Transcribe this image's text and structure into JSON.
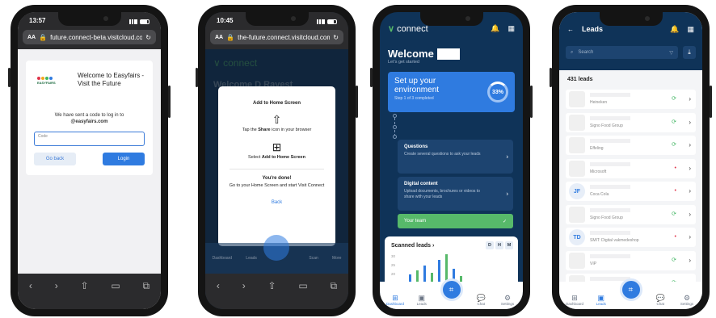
{
  "phone1": {
    "time": "13:57",
    "url": "future.connect-beta.visitcloud.com",
    "url_aa": "AA",
    "logo_text": "EASYFAIRS",
    "welcome": "Welcome to Easyfairs - Visit the Future",
    "sent_line": "We have sent a code to log in to",
    "sent_domain": "@easyfairs.com",
    "code_label": "Code",
    "back_label": "Go back",
    "login_label": "Login"
  },
  "phone2": {
    "time": "10:45",
    "url": "the-future.connect.visitcloud.com",
    "url_aa": "AA",
    "bg_logo": "connect",
    "bg_welcome": "Welcome D Ravest",
    "modal": {
      "title": "Add to Home Screen",
      "step1_pre": "Tap the",
      "step1_bold": "Share",
      "step1_post": "icon in your browser",
      "step2_pre": "Select",
      "step2_bold": "Add to Home Screen",
      "done_title": "You're done!",
      "done_text": "Go to your Home Screen and start Visit Connect",
      "back_label": "Back"
    },
    "tabs": [
      "Dashboard",
      "Leads",
      "Scan",
      "More"
    ]
  },
  "phone3": {
    "brand_main": "connect",
    "welcome": "Welcome",
    "subtitle": "Let's get started",
    "setup_title": "Set up your environment",
    "setup_sub": "Step 1 of 3 completed",
    "progress_label": "33%",
    "progress_value": 33,
    "tasks": [
      {
        "title": "Questions",
        "desc": "Create several questions to ask your leads"
      },
      {
        "title": "Digital content",
        "desc": "Upload documents, brochures or videos to share with your leads"
      }
    ],
    "team_label": "Your team",
    "scanned_title": "Scanned leads",
    "ranges": [
      "D",
      "H",
      "M"
    ],
    "tabs": [
      "Dashboard",
      "Leads",
      "Chat",
      "Settings"
    ],
    "chart_data": {
      "type": "bar",
      "title": "Scanned leads",
      "ticks": [
        "30",
        "25",
        "20"
      ],
      "ylim": [
        0,
        30
      ],
      "series": [
        {
          "values": [
            8,
            12,
            18,
            10,
            24,
            30,
            14,
            6
          ]
        }
      ]
    }
  },
  "phone4": {
    "title": "Leads",
    "search_placeholder": "Search",
    "count_label": "431 leads",
    "leads": [
      {
        "initials": "",
        "company": "Heineken",
        "status": "green"
      },
      {
        "initials": "",
        "company": "Signo Food Group",
        "status": "green"
      },
      {
        "initials": "",
        "company": "Effeling",
        "status": "green"
      },
      {
        "initials": "",
        "company": "Microsoft",
        "status": "red"
      },
      {
        "initials": "JF",
        "company": "Coca Cola",
        "status": "red"
      },
      {
        "initials": "",
        "company": "Signo Food Group",
        "status": "green"
      },
      {
        "initials": "TD",
        "company": "SMIT: Digital vakmedeshop",
        "status": "red"
      },
      {
        "initials": "",
        "company": "VIP",
        "status": "green"
      },
      {
        "initials": "",
        "company": "Coca Cola",
        "status": "green"
      }
    ],
    "tabs": [
      "Dashboard",
      "Leads",
      "Chat",
      "Settings"
    ],
    "colors": {
      "green": "#3fb561",
      "red": "#e0334a",
      "navy": "#0f3358",
      "blue": "#2f7be0"
    }
  }
}
